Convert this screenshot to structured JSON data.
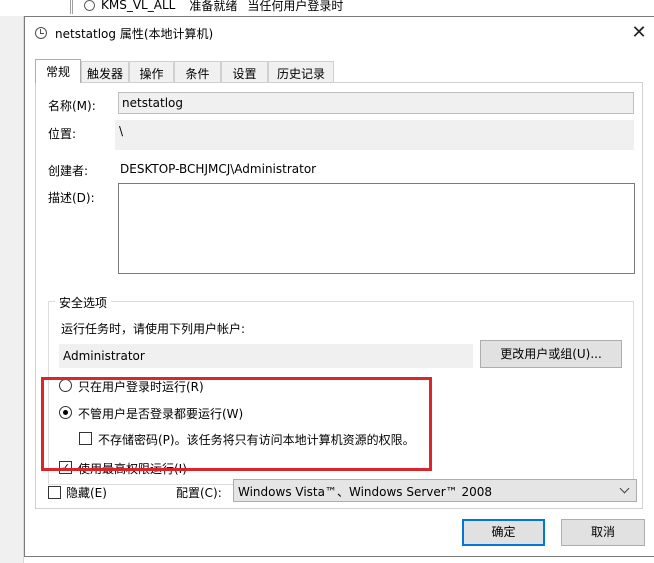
{
  "background": {
    "task_name": "KMS_VL_ALL",
    "task_status": "准备就绪",
    "task_trigger": "当任何用户登录时"
  },
  "dialog": {
    "title": "netstatlog 属性(本地计算机)",
    "tabs": [
      "常规",
      "触发器",
      "操作",
      "条件",
      "设置",
      "历史记录"
    ],
    "general": {
      "name_label": "名称(M):",
      "name_value": "netstatlog",
      "location_label": "位置:",
      "location_value": "\\",
      "author_label": "创建者:",
      "author_value": "DESKTOP-BCHJMCJ\\Administrator",
      "description_label": "描述(D):",
      "description_value": ""
    },
    "security": {
      "legend": "安全选项",
      "run_as_prompt": "运行任务时，请使用下列用户帐户:",
      "account": "Administrator",
      "change_user_button": "更改用户或组(U)...",
      "radio_logged_on": "只在用户登录时运行(R)",
      "radio_whether": "不管用户是否登录都要运行(W)",
      "no_store_password": "不存储密码(P)。该任务将只有访问本地计算机资源的权限。",
      "highest_privileges": "使用最高权限运行(I)",
      "selected_radio": "whether_logged_on",
      "no_store_password_checked": false,
      "highest_privileges_checked": true
    },
    "hidden_label": "隐藏(E)",
    "hidden_checked": false,
    "configure_label": "配置(C):",
    "configure_value": "Windows Vista™、Windows Server™ 2008",
    "ok_button": "确定",
    "cancel_button": "取消",
    "highlight_color": "#d9262c"
  }
}
